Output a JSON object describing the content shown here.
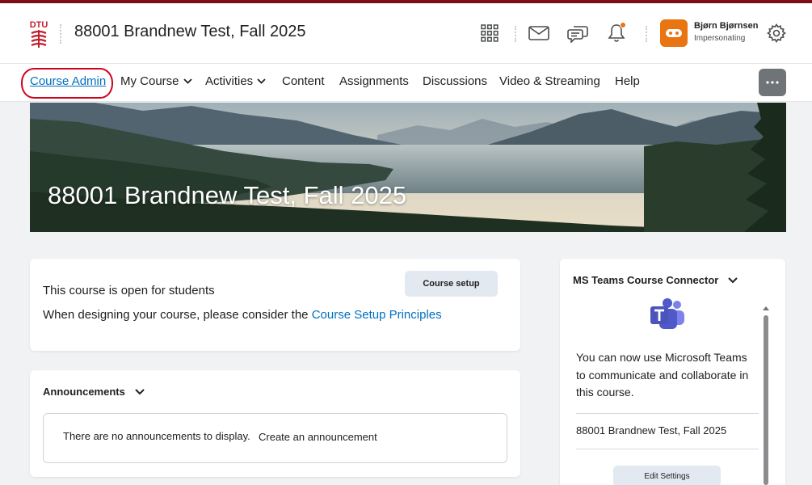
{
  "header": {
    "logo_text": "DTU",
    "course_title": "88001 Brandnew Test, Fall 2025",
    "icons": [
      "waffle-grid-icon",
      "email-icon",
      "chat-icon",
      "bell-icon",
      "gear-icon"
    ],
    "notification_color": "#e87511",
    "user": {
      "name": "Bjørn Bjørnsen",
      "role": "Impersonating",
      "avatar_color": "#e87511"
    }
  },
  "nav": {
    "items": [
      {
        "label": "Course Admin",
        "active": true
      },
      {
        "label": "My Course",
        "has_dropdown": true
      },
      {
        "label": "Activities",
        "has_dropdown": true
      },
      {
        "label": "Content"
      },
      {
        "label": "Assignments"
      },
      {
        "label": "Discussions"
      },
      {
        "label": "Video & Streaming"
      },
      {
        "label": "Help"
      }
    ],
    "more_icon": "ellipsis-icon",
    "accent_color": "#006fbf",
    "highlight_color": "#d0021b"
  },
  "banner": {
    "title": "88001 Brandnew Test, Fall 2025"
  },
  "setup_card": {
    "button_label": "Course setup",
    "status_text": "This course is open for students",
    "principles_prefix": "When designing your course, please consider the ",
    "principles_link": "Course Setup Principles"
  },
  "announcements": {
    "title": "Announcements",
    "empty_text": "There are no announcements to display.",
    "create_link": "Create an announcement"
  },
  "teams_widget": {
    "title": "MS Teams Course Connector",
    "icon": "ms-teams-icon",
    "description_lines": [
      "You can now use Microsoft Teams",
      "to communicate and collaborate in",
      "this course."
    ],
    "course_link": "88001 Brandnew Test, Fall 2025",
    "button_label": "Edit Settings"
  }
}
